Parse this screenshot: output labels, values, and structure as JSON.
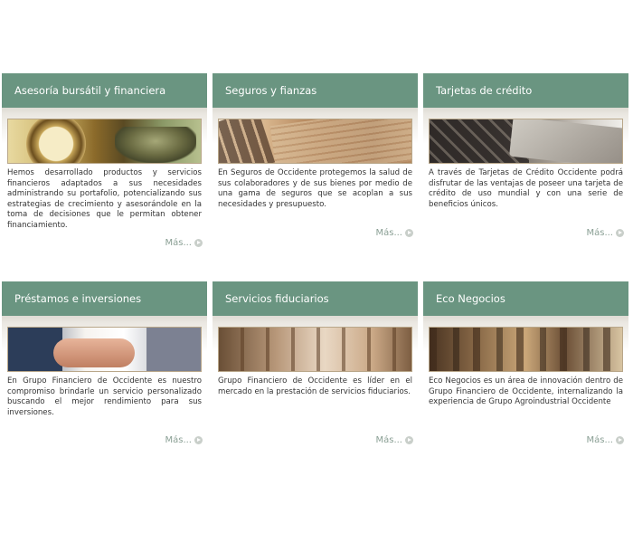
{
  "cards": [
    {
      "title": "Asesoría bursátil y financiera",
      "image": "watch-and-banknote-image",
      "description": "Hemos desarrollado productos y servicios financieros adaptados a sus necesidades administrando su portafolio, potencializando sus estrategias de crecimiento y asesorándole en la toma de decisiones que le permitan obtener financiamiento.",
      "more": "Más..."
    },
    {
      "title": "Seguros y fianzas",
      "image": "financial-newspaper-calculator-image",
      "description": "En Seguros de Occidente protegemos la salud de sus colaboradores y de sus bienes por medio de una gama de seguros que se acoplan a sus necesidades y presupuesto.",
      "more": "Más..."
    },
    {
      "title": "Tarjetas de crédito",
      "image": "credit-card-keyboard-image",
      "description": "A través de Tarjetas de Crédito Occidente podrá disfrutar de las ventajas de poseer una tarjeta de crédito de uso mundial y con una serie de beneficios únicos.",
      "more": "Más..."
    },
    {
      "title": "Préstamos e inversiones",
      "image": "handshake-image",
      "description": "En Grupo Financiero de Occidente es nuestro compromiso brindarle un servicio personalizado buscando el mejor rendimiento para sus inversiones.",
      "more": "Más..."
    },
    {
      "title": "Servicios fiduciarios",
      "image": "office-building-interior-image",
      "description": "Grupo Financiero de Occidente es líder en el mercado en la prestación de servicios fiduciarios.",
      "more": "Más..."
    },
    {
      "title": "Eco Negocios",
      "image": "forest-trees-image",
      "description": "Eco Negocios es un área de innovación dentro de Grupo Financiero de Occidente, internalizando la experiencia de Grupo Agroindustrial Occidente",
      "more": "Más..."
    }
  ],
  "colors": {
    "header_bg": "#6a9581",
    "header_text": "#ffffff",
    "more_link": "#8a9f94"
  }
}
